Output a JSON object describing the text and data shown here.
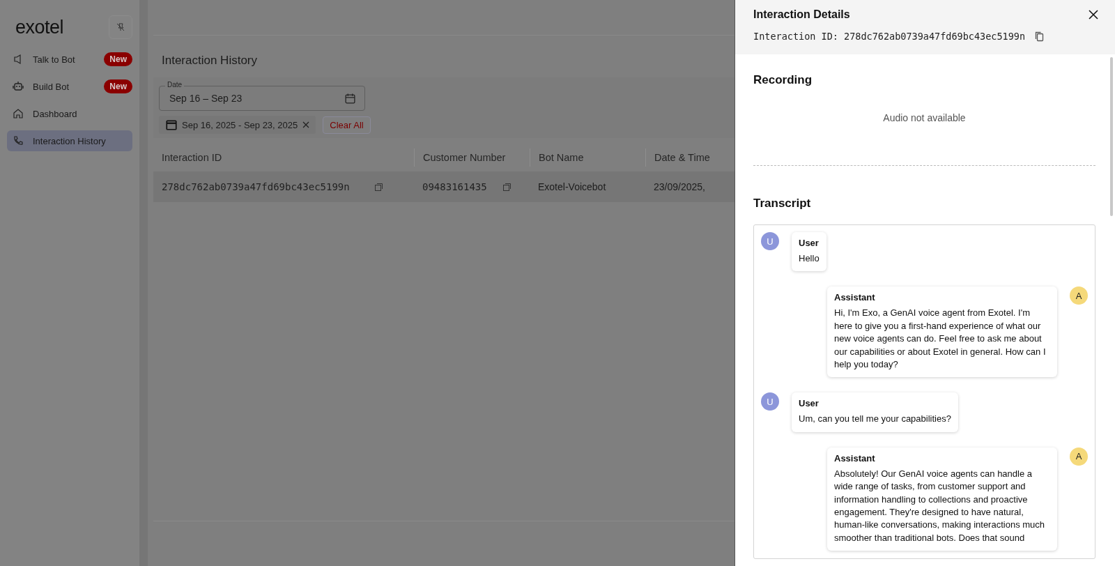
{
  "sidebar": {
    "logo": "exotel",
    "items": [
      {
        "label": "Talk to Bot",
        "badge": "New",
        "selected": false
      },
      {
        "label": "Build Bot",
        "badge": "New",
        "selected": false
      },
      {
        "label": "Dashboard",
        "selected": false
      },
      {
        "label": "Interaction History",
        "selected": true
      }
    ]
  },
  "main": {
    "title": "Interaction History",
    "date_field": {
      "label": "Date",
      "value": "Sep 16 – Sep 23"
    },
    "filter_chip": "Sep 16, 2025 - Sep 23, 2025",
    "clear_button": "Clear All",
    "table": {
      "columns": [
        "Interaction ID",
        "Customer Number",
        "Bot Name",
        "Date & Time"
      ],
      "rows": [
        {
          "cells": [
            "278dc762ab0739a47fd69bc43ec5199n",
            "09483161435",
            "Exotel-Voicebot",
            "23/09/2025,"
          ]
        }
      ]
    }
  },
  "drawer": {
    "title": "Interaction Details",
    "id_label": "Interaction ID: 278dc762ab0739a47fd69bc43ec5199n",
    "recording": {
      "heading": "Recording",
      "message": "Audio not available"
    },
    "transcript": {
      "heading": "Transcript",
      "messages": [
        {
          "kind": "user",
          "avatar": "U",
          "speaker": "User",
          "text": "Hello"
        },
        {
          "kind": "assistant",
          "avatar": "A",
          "speaker": "Assistant",
          "text": "Hi, I'm Exo, a GenAI voice agent from Exotel. I'm here to give you a first-hand experience of what our new voice agents can do. Feel free to ask me about our capabilities or about Exotel in general. How can I help you today?"
        },
        {
          "kind": "user",
          "avatar": "U",
          "speaker": "User",
          "text": "Um, can you tell me your capabilities?"
        },
        {
          "kind": "assistant",
          "avatar": "A",
          "speaker": "Assistant",
          "text": "Absolutely! Our GenAI voice agents can handle a wide range of tasks, from customer support and information handling to collections and proactive engagement. They're designed to have natural, human-like conversations, making interactions much smoother than traditional bots. Does that sound"
        }
      ]
    }
  }
}
